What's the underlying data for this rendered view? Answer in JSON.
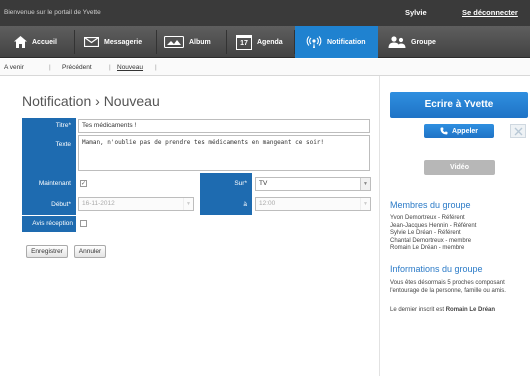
{
  "topbar": {
    "welcome": "Bienvenue sur le portail de Yvette",
    "user": "Sylvie",
    "logout": "Se déconnecter"
  },
  "nav": {
    "items": [
      {
        "label": "Accueil",
        "icon": "home-icon"
      },
      {
        "label": "Messagerie",
        "icon": "envelope-icon"
      },
      {
        "label": "Album",
        "icon": "photo-icon"
      },
      {
        "label": "Agenda",
        "icon": "calendar-icon"
      },
      {
        "label": "Notification",
        "icon": "broadcast-icon",
        "active": true
      },
      {
        "label": "Groupe",
        "icon": "group-icon"
      }
    ],
    "calendar_day": "17",
    "active_color": "#1f82d0"
  },
  "subnav": {
    "items": [
      "A venir",
      "Précédent",
      "Nouveau"
    ],
    "separator": "|"
  },
  "page": {
    "title": "Notification › Nouveau"
  },
  "form": {
    "title_label": "Titre*",
    "title_value": "Tes médicaments !",
    "text_label": "Texte",
    "text_value": "Maman, n'oublie pas de prendre tes médicaments en mangeant ce soir!",
    "now_label": "Maintenant",
    "now_checked": "✓",
    "on_label": "Sur*",
    "on_value": "TV",
    "start_label": "Début*",
    "start_value": "16-11-2012",
    "at_label": "à",
    "at_value": "12:00",
    "receipt_label": "Avis réception",
    "save_button": "Enregistrer",
    "cancel_button": "Annuler"
  },
  "sidebar": {
    "write_button": "Ecrire à Yvette",
    "call_button": "Appeler",
    "video_button": "Vidéo",
    "members_title": "Membres du groupe",
    "members": [
      "Yvon Demortreux - Référent",
      "Jean-Jacques Hennin - Référent",
      "Sylvie Le Dréan - Référent",
      "Chantal Demortreux - membre",
      "Romain Le Dréan - membre"
    ],
    "info_title": "Informations du groupe",
    "info_text": "Vous êtes désormais 5 proches composant l'entourage de la personne, famille ou amis.",
    "last_prefix": "Le dernier inscrit est",
    "last_name": "Romain Le Dréan"
  },
  "colors": {
    "accent": "#1f73c6",
    "label_bg": "#1e6bb0",
    "heading_blue": "#2a7ac7"
  }
}
